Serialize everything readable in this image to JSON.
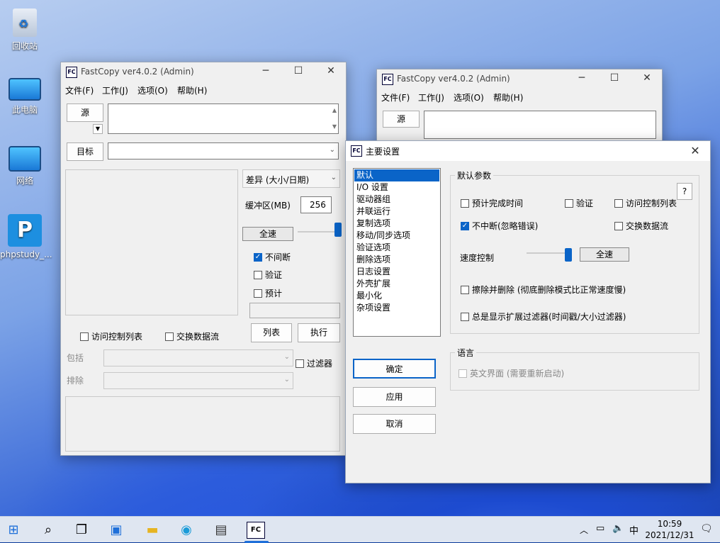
{
  "desktop": {
    "icons": [
      {
        "label": "回收站",
        "icon": "recycle-bin-icon"
      },
      {
        "label": "此电脑",
        "icon": "computer-icon"
      },
      {
        "label": "网络",
        "icon": "network-icon"
      },
      {
        "label": "phpstudy_...",
        "icon": "phpstudy-icon"
      }
    ]
  },
  "main": {
    "title": "FastCopy ver4.0.2 (Admin)",
    "icon": "FC",
    "menu": [
      "文件(F)",
      "工作(J)",
      "选项(O)",
      "帮助(H)"
    ],
    "src_label": "源",
    "dst_label": "目标",
    "mode": "差异 (大小/日期)",
    "buffer_label": "缓冲区(MB)",
    "buffer_value": "256",
    "speed_label": "全速",
    "check_nonstop": "不间断",
    "check_verify": "验证",
    "check_estimate": "预计",
    "check_acl": "访问控制列表",
    "check_stream": "交换数据流",
    "list_btn": "列表",
    "exec_btn": "执行",
    "include_label": "包括",
    "exclude_label": "排除",
    "filter_label": "过滤器"
  },
  "bg": {
    "title": "FastCopy ver4.0.2 (Admin)",
    "menu": [
      "文件(F)",
      "工作(J)",
      "选项(O)",
      "帮助(H)"
    ],
    "src_label": "源"
  },
  "dialog": {
    "title": "主要设置",
    "categories": [
      "默认",
      "I/O 设置",
      "驱动器组",
      "并联运行",
      "复制选项",
      "移动/同步选项",
      "验证选项",
      "删除选项",
      "日志设置",
      "外壳扩展",
      "最小化",
      "杂项设置"
    ],
    "selected": "默认",
    "group_title": "默认参数",
    "help": "?",
    "estimate": "预计完成时间",
    "verify": "验证",
    "acl": "访问控制列表",
    "nonstop": "不中断(忽略错误)",
    "stream": "交换数据流",
    "speed_label": "速度控制",
    "speed_value": "全速",
    "wipe": "擦除并删除 (彻底删除模式比正常速度慢)",
    "ext_filter": "总是显示扩展过滤器(时间戳/大小过滤器)",
    "lang_title": "语言",
    "english": "英文界面 (需要重新启动)",
    "ok": "确定",
    "apply": "应用",
    "cancel": "取消"
  },
  "taskbar": {
    "time": "10:59",
    "date": "2021/12/31",
    "ime": "中"
  }
}
